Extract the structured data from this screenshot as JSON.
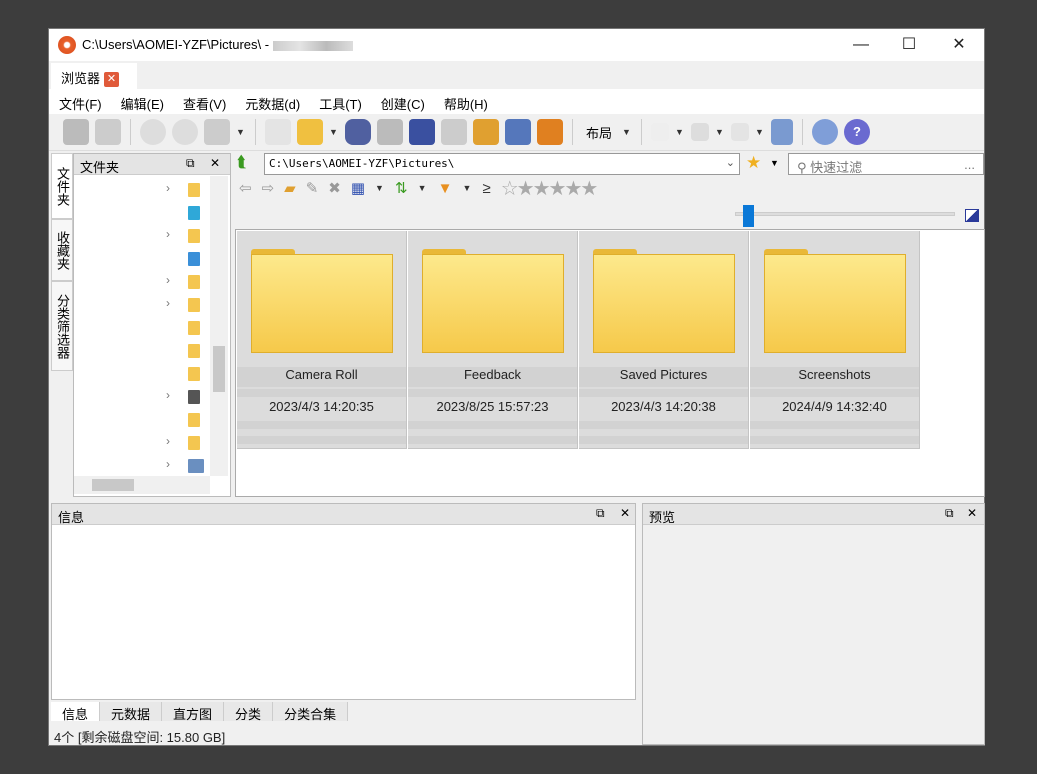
{
  "title": {
    "path": "C:\\Users\\AOMEI-YZF\\Pictures\\ -",
    "minimize": "—",
    "maximize": "☐",
    "close": "✕"
  },
  "tab": {
    "label": "浏览器",
    "close": "✕"
  },
  "menu": [
    "文件(F)",
    "编辑(E)",
    "查看(V)",
    "元数据(d)",
    "工具(T)",
    "创建(C)",
    "帮助(H)"
  ],
  "toolbar": {
    "layout_label": "布局"
  },
  "side_tabs": [
    "文件夹",
    "收藏夹",
    "分类筛选器"
  ],
  "folder_panel": {
    "title": "文件夹"
  },
  "address": {
    "value": "C:\\Users\\AOMEI-YZF\\Pictures\\"
  },
  "filter": {
    "placeholder": "快速过滤",
    "more": "..."
  },
  "rating_label": "≥",
  "thumbnails": [
    {
      "name": "Camera Roll",
      "date": "2023/4/3 14:20:35"
    },
    {
      "name": "Feedback",
      "date": "2023/8/25 15:57:23"
    },
    {
      "name": "Saved Pictures",
      "date": "2023/4/3 14:20:38"
    },
    {
      "name": "Screenshots",
      "date": "2024/4/9 14:32:40"
    }
  ],
  "info_panel": {
    "title": "信息"
  },
  "preview_panel": {
    "title": "预览"
  },
  "bottom_tabs": [
    "信息",
    "元数据",
    "直方图",
    "分类",
    "分类合集"
  ],
  "status": "4个 [剩余磁盘空间: 15.80 GB]",
  "colors": {
    "accent": "#0a78d7",
    "folder": "#f6c94a",
    "tab_close": "#e05a3a"
  }
}
